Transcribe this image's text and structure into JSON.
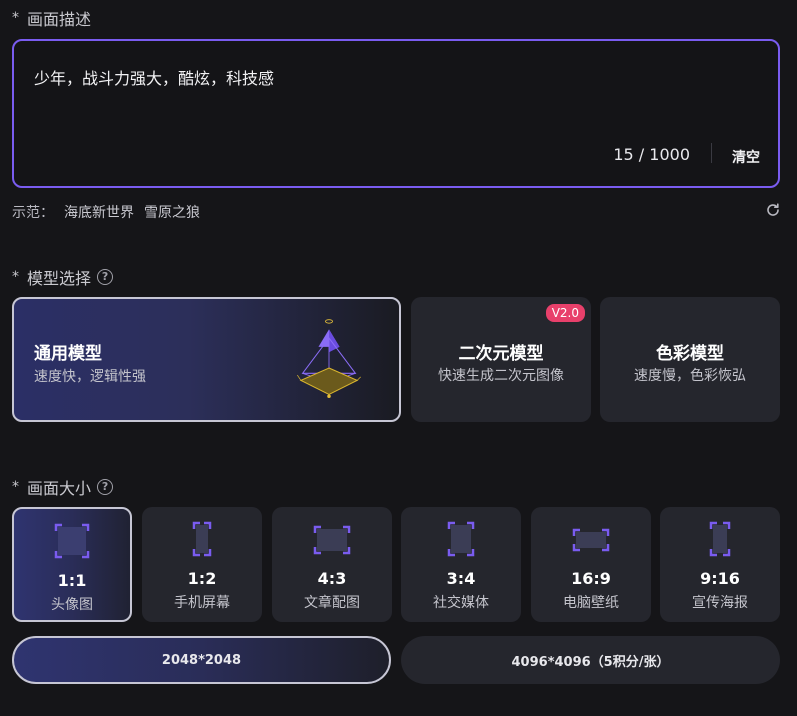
{
  "description": {
    "required_mark": "*",
    "title": "画面描述",
    "prompt_value": "少年，战斗力强大，酷炫，科技感",
    "counter": "15 / 1000",
    "clear_label": "清空",
    "examples_label": "示范：",
    "examples": [
      "海底新世界",
      "雪原之狼"
    ]
  },
  "model": {
    "required_mark": "*",
    "title": "模型选择",
    "help": "?",
    "cards": [
      {
        "name": "通用模型",
        "desc": "速度快，逻辑性强",
        "selected": true
      },
      {
        "name": "二次元模型",
        "desc": "快速生成二次元图像",
        "badge": "V2.0"
      },
      {
        "name": "色彩模型",
        "desc": "速度慢，色彩恢弘"
      }
    ]
  },
  "size": {
    "required_mark": "*",
    "title": "画面大小",
    "help": "?",
    "options": [
      {
        "ratio": "1:1",
        "desc": "头像图",
        "selected": true
      },
      {
        "ratio": "1:2",
        "desc": "手机屏幕"
      },
      {
        "ratio": "4:3",
        "desc": "文章配图"
      },
      {
        "ratio": "3:4",
        "desc": "社交媒体"
      },
      {
        "ratio": "16:9",
        "desc": "电脑壁纸"
      },
      {
        "ratio": "9:16",
        "desc": "宣传海报"
      }
    ]
  },
  "resolution": {
    "options": [
      {
        "label": "2048*2048",
        "selected": true
      },
      {
        "label": "4096*4096（5积分/张）"
      }
    ]
  },
  "colors": {
    "accent": "#7a5cf0",
    "badge": "#e8406b",
    "card_bg": "#25262d",
    "page_bg": "#151518",
    "ratio_icon": "#7a5cf0"
  }
}
